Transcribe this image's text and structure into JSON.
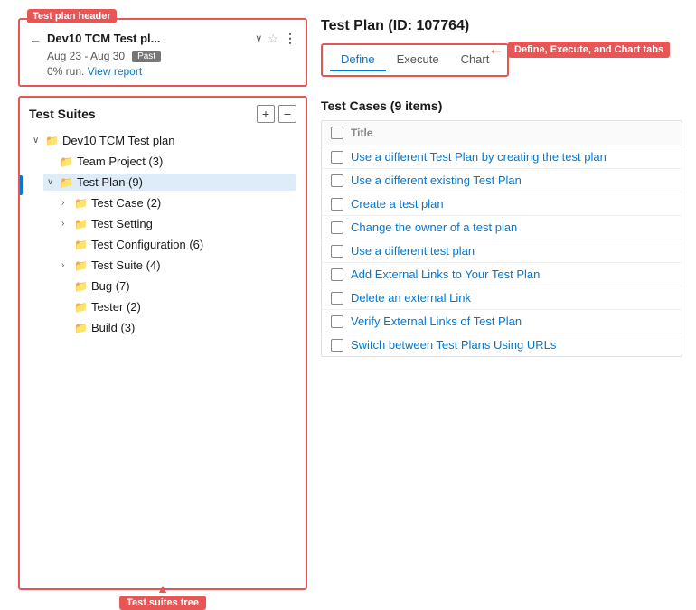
{
  "annotations": {
    "header_badge": "Test plan header",
    "suites_badge": "Test suites tree",
    "tabs_badge": "Define, Execute,\nand Chart tabs"
  },
  "left_panel": {
    "plan": {
      "title": "Dev10 TCM Test pl...",
      "date_range": "Aug 23 - Aug 30",
      "status": "Past",
      "run_pct": "0% run.",
      "view_report": "View report"
    },
    "suites": {
      "title": "Test Suites",
      "add_btn": "+",
      "remove_btn": "−",
      "tree": [
        {
          "indent": 1,
          "expanded": true,
          "has_expand": true,
          "label": "Dev10 TCM Test plan",
          "count": ""
        },
        {
          "indent": 2,
          "expanded": false,
          "has_expand": false,
          "label": "Team Project (3)",
          "count": ""
        },
        {
          "indent": 2,
          "expanded": true,
          "has_expand": true,
          "label": "Test Plan (9)",
          "count": "",
          "selected": true
        },
        {
          "indent": 3,
          "expanded": false,
          "has_expand": true,
          "label": "Test Case (2)",
          "count": ""
        },
        {
          "indent": 3,
          "expanded": false,
          "has_expand": true,
          "label": "Test Setting",
          "count": ""
        },
        {
          "indent": 3,
          "expanded": false,
          "has_expand": false,
          "label": "Test Configuration (6)",
          "count": ""
        },
        {
          "indent": 3,
          "expanded": false,
          "has_expand": true,
          "label": "Test Suite (4)",
          "count": ""
        },
        {
          "indent": 3,
          "expanded": false,
          "has_expand": false,
          "label": "Bug (7)",
          "count": ""
        },
        {
          "indent": 3,
          "expanded": false,
          "has_expand": false,
          "label": "Tester (2)",
          "count": ""
        },
        {
          "indent": 3,
          "expanded": false,
          "has_expand": false,
          "label": "Build (3)",
          "count": ""
        }
      ]
    }
  },
  "right_panel": {
    "plan_id_title": "Test Plan (ID: 107764)",
    "tabs": [
      {
        "label": "Define",
        "active": true
      },
      {
        "label": "Execute",
        "active": false
      },
      {
        "label": "Chart",
        "active": false
      }
    ],
    "test_cases_title": "Test Cases (9 items)",
    "col_title": "Title",
    "items": [
      "Use a different Test Plan by creating the test plan",
      "Use a different existing Test Plan",
      "Create a test plan",
      "Change the owner of a test plan",
      "Use a different test plan",
      "Add External Links to Your Test Plan",
      "Delete an external Link",
      "Verify External Links of Test Plan",
      "Switch between Test Plans Using URLs"
    ]
  }
}
